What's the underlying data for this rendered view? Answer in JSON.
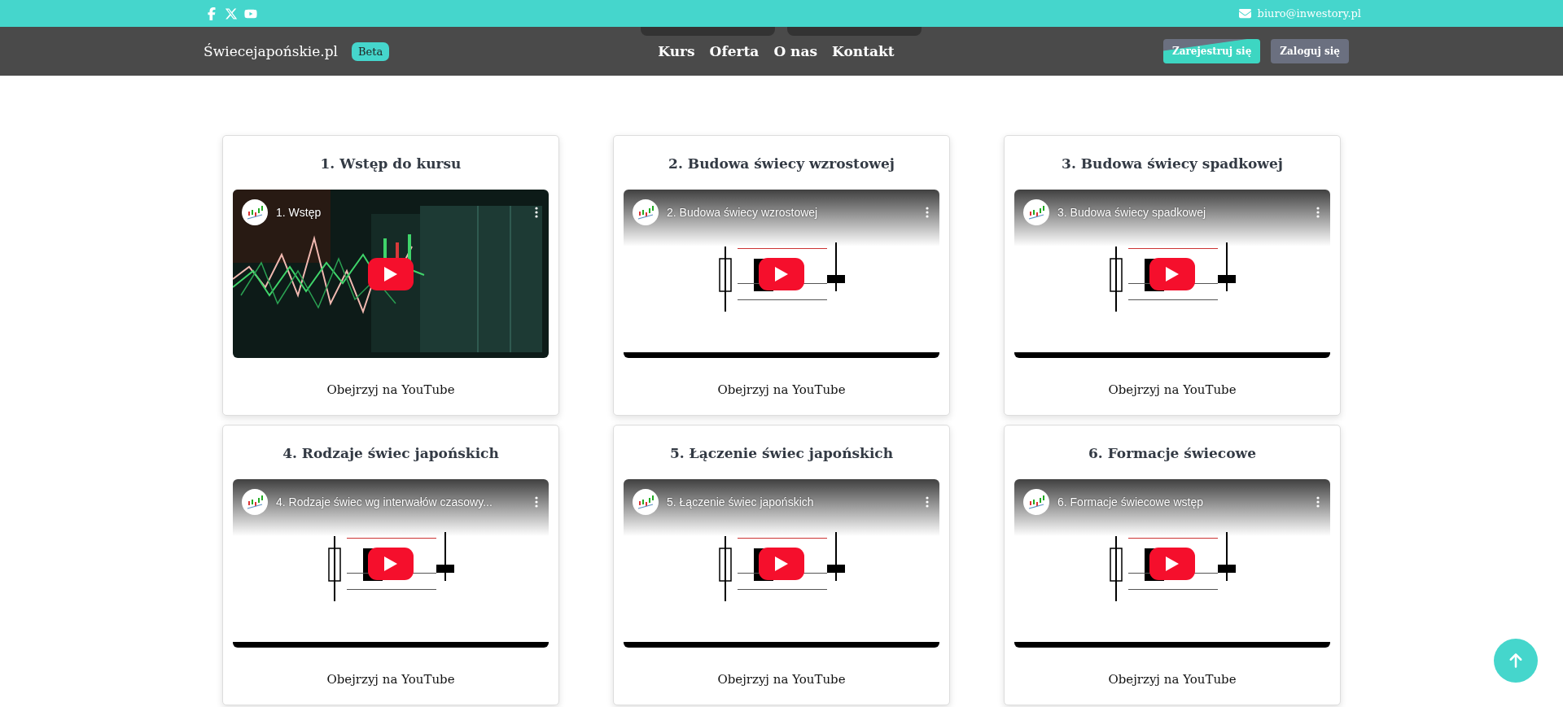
{
  "topbar": {
    "email": "biuro@inwestory.pl"
  },
  "nav": {
    "logo": "Świecejapońskie.pl",
    "badge": "Beta",
    "links": [
      "Kurs",
      "Oferta",
      "O nas",
      "Kontakt"
    ],
    "register": "Zarejestruj się",
    "login": "Zaloguj się"
  },
  "lessons": [
    {
      "title": "1. Wstęp do kursu",
      "video_title": "1. Wstęp",
      "link": "Obejrzyj na YouTube"
    },
    {
      "title": "2. Budowa świecy wzrostowej",
      "video_title": "2. Budowa świecy wzrostowej",
      "link": "Obejrzyj na YouTube"
    },
    {
      "title": "3. Budowa świecy spadkowej",
      "video_title": "3. Budowa świecy spadkowej",
      "link": "Obejrzyj na YouTube"
    },
    {
      "title": "4. Rodzaje świec japońskich",
      "video_title": "4. Rodzaje świec wg interwałów czasowy...",
      "link": "Obejrzyj na YouTube"
    },
    {
      "title": "5. Łączenie świec japońskich",
      "video_title": "5. Łączenie świec japońskich",
      "link": "Obejrzyj na YouTube"
    },
    {
      "title": "6. Formacje świecowe",
      "video_title": "6. Formacje świecowe wstęp",
      "link": "Obejrzyj na YouTube"
    }
  ]
}
